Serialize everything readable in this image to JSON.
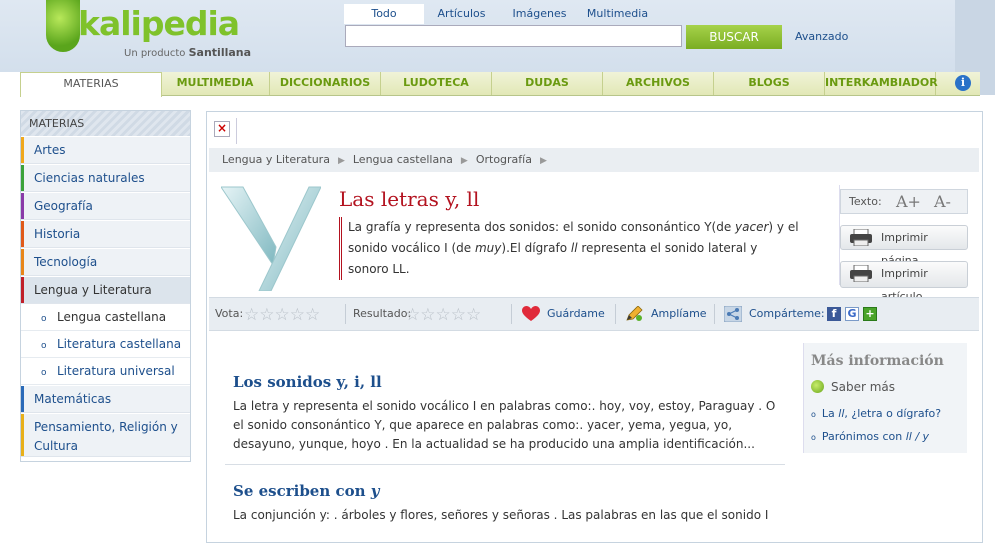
{
  "header": {
    "logo_text": "kalipedia",
    "logo_subtitle_prefix": "Un producto",
    "logo_subtitle_brand": "Santillana",
    "search_tabs": [
      "Todo",
      "Artículos",
      "Imágenes",
      "Multimedia"
    ],
    "active_search_tab": "Todo",
    "search_value": "",
    "search_button": "BUSCAR",
    "advanced_link": "Avanzado"
  },
  "nav": {
    "items": [
      "MATERIAS",
      "MULTIMEDIA",
      "DICCIONARIOS",
      "LUDOTECA",
      "DUDAS",
      "ARCHIVOS",
      "BLOGS",
      "INTERKAMBIADOR"
    ],
    "active": "MATERIAS",
    "info_icon": "info-icon"
  },
  "sidebar": {
    "title": "MATERIAS",
    "items": [
      {
        "label": "Artes",
        "color": "#f0a81c"
      },
      {
        "label": "Ciencias naturales",
        "color": "#3aa23a"
      },
      {
        "label": "Geografía",
        "color": "#8a3aa8"
      },
      {
        "label": "Historia",
        "color": "#e05a1a"
      },
      {
        "label": "Tecnología",
        "color": "#e8861a"
      },
      {
        "label": "Lengua y Literatura",
        "color": "#c0202a"
      }
    ],
    "subitems": [
      "Lengua castellana",
      "Literatura castellana",
      "Literatura universal"
    ],
    "current_subitem": "Lengua castellana",
    "bottom_items": [
      {
        "label": "Matemáticas",
        "color": "#2a6ab8"
      },
      {
        "label": "Pensamiento, Religión y Cultura",
        "color": "#e8b01a"
      }
    ]
  },
  "article": {
    "close_icon": "close-icon",
    "breadcrumb": [
      "Lengua y Literatura",
      "Lengua castellana",
      "Ortografía"
    ],
    "title": "Las letras y, ll",
    "lead_1": "La grafía y representa dos sonidos: el sonido consonántico Y(de ",
    "lead_1_em": "yacer",
    "lead_2": ") y el sonido vocálico I (de ",
    "lead_2_em": "muy",
    "lead_3": ").El dígrafo ",
    "lead_3_em": "ll",
    "lead_4": " representa el sonido lateral y sonoro LL.",
    "tools": {
      "text_label": "Texto:",
      "increase": "A+",
      "decrease": "A-",
      "print_page": "Imprimir página",
      "print_article": "Imprimir artículo"
    },
    "actions": {
      "vote_label": "Vota:",
      "result_label": "Resultado:",
      "save": "Guárdame",
      "expand": "Amplíame",
      "share": "Compárteme:",
      "star_glyph": "☆☆☆☆☆",
      "share_icons": [
        "f",
        "G",
        "+"
      ]
    },
    "sections": [
      {
        "title": "Los sonidos y, i, ll",
        "text": "La letra y representa el sonido vocálico I en palabras como:. hoy, voy, estoy, Paraguay . O el sonido consonántico Y, que aparece en palabras como:. yacer, yema, yegua, yo, desayuno, yunque, hoyo . En la actualidad se ha producido una amplia identificación..."
      },
      {
        "title_prefix": "Se escriben con ",
        "title_em": "y",
        "text": "La conjunción y: . árboles y flores, señores y señoras . Las palabras en las que el sonido I"
      }
    ],
    "more_info": {
      "title": "Más información",
      "subtitle": "Saber más",
      "link_1_prefix": "La ",
      "link_1_em": "ll",
      "link_1_suffix": ", ¿letra o dígrafo?",
      "link_2_prefix": "Parónimos con ",
      "link_2_em": "ll / y",
      "bullet": "o"
    }
  }
}
